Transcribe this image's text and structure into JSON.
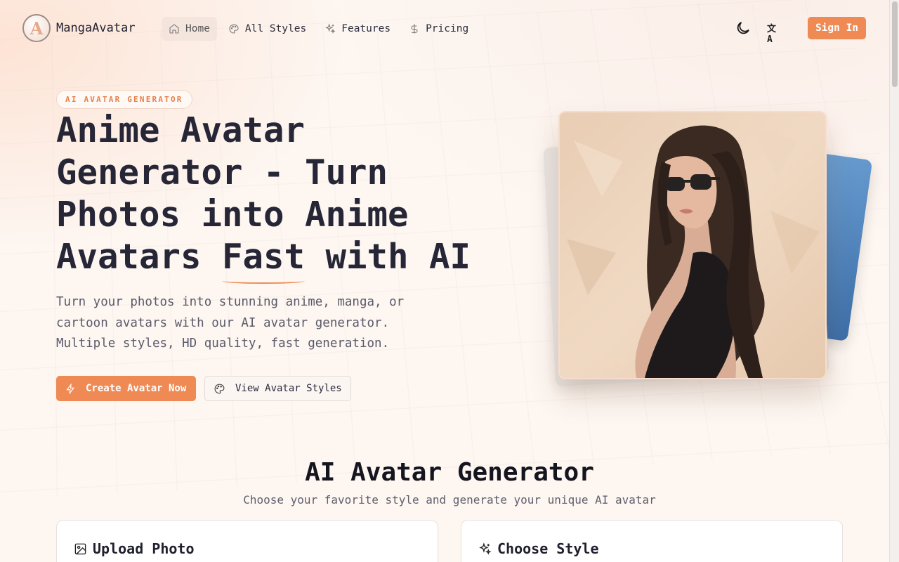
{
  "brand": {
    "name": "MangaAvatar",
    "logo_letter": "A"
  },
  "nav": {
    "items": [
      {
        "label": "Home",
        "icon": "home-icon"
      },
      {
        "label": "All Styles",
        "icon": "palette-icon"
      },
      {
        "label": "Features",
        "icon": "sparkles-icon"
      },
      {
        "label": "Pricing",
        "icon": "dollar-icon"
      }
    ],
    "theme_icon": "moon-icon",
    "language_icon": "translate-icon",
    "language_glyph": "文A",
    "signin_label": "Sign In"
  },
  "hero": {
    "badge": "AI AVATAR GENERATOR",
    "title_pre": "Anime Avatar Generator - Turn Photos into Anime Avatars ",
    "title_highlight": "Fast",
    "title_post": " with AI",
    "description": "Turn your photos into stunning anime, manga, or cartoon avatars with our AI avatar generator. Multiple styles, HD quality, fast generation.",
    "primary_cta": "Create Avatar Now",
    "secondary_cta": "View Avatar Styles",
    "image_subject": "painted portrait of woman with sunglasses"
  },
  "generator": {
    "title": "AI Avatar Generator",
    "subtitle": "Choose your favorite style and generate your unique AI avatar",
    "upload_title": "Upload Photo",
    "style_title": "Choose Style"
  },
  "colors": {
    "accent": "#ef8a55",
    "text": "#262637",
    "background": "#fdf6f1"
  }
}
